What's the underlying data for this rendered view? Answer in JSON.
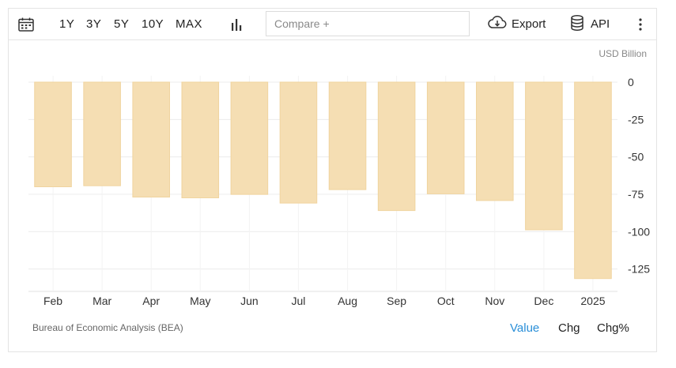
{
  "toolbar": {
    "range_buttons": [
      "1Y",
      "3Y",
      "5Y",
      "10Y",
      "MAX"
    ],
    "compare_placeholder": "Compare +",
    "export_label": "Export",
    "api_label": "API",
    "icons": [
      "calendar-icon",
      "bar-chart-icon",
      "cloud-download-icon",
      "database-icon",
      "more-vertical-icon"
    ]
  },
  "chart_data": {
    "type": "bar",
    "unit": "USD Billion",
    "categories": [
      "Feb",
      "Mar",
      "Apr",
      "May",
      "Jun",
      "Jul",
      "Aug",
      "Sep",
      "Oct",
      "Nov",
      "Dec",
      "2025"
    ],
    "values": [
      -70.0,
      -69.3,
      -76.9,
      -77.4,
      -75.1,
      -80.9,
      -71.9,
      -85.9,
      -74.7,
      -79.2,
      -98.8,
      -131.4
    ],
    "ylim": [
      -140,
      0
    ],
    "yticks": [
      0,
      -25,
      -50,
      -75,
      -100,
      -125
    ],
    "grid": true,
    "bar_color": "#f5deb3"
  },
  "footer": {
    "source": "Bureau of Economic Analysis (BEA)",
    "views": [
      "Value",
      "Chg",
      "Chg%"
    ],
    "active_view": "Value",
    "active_color": "#2a8fd8"
  }
}
